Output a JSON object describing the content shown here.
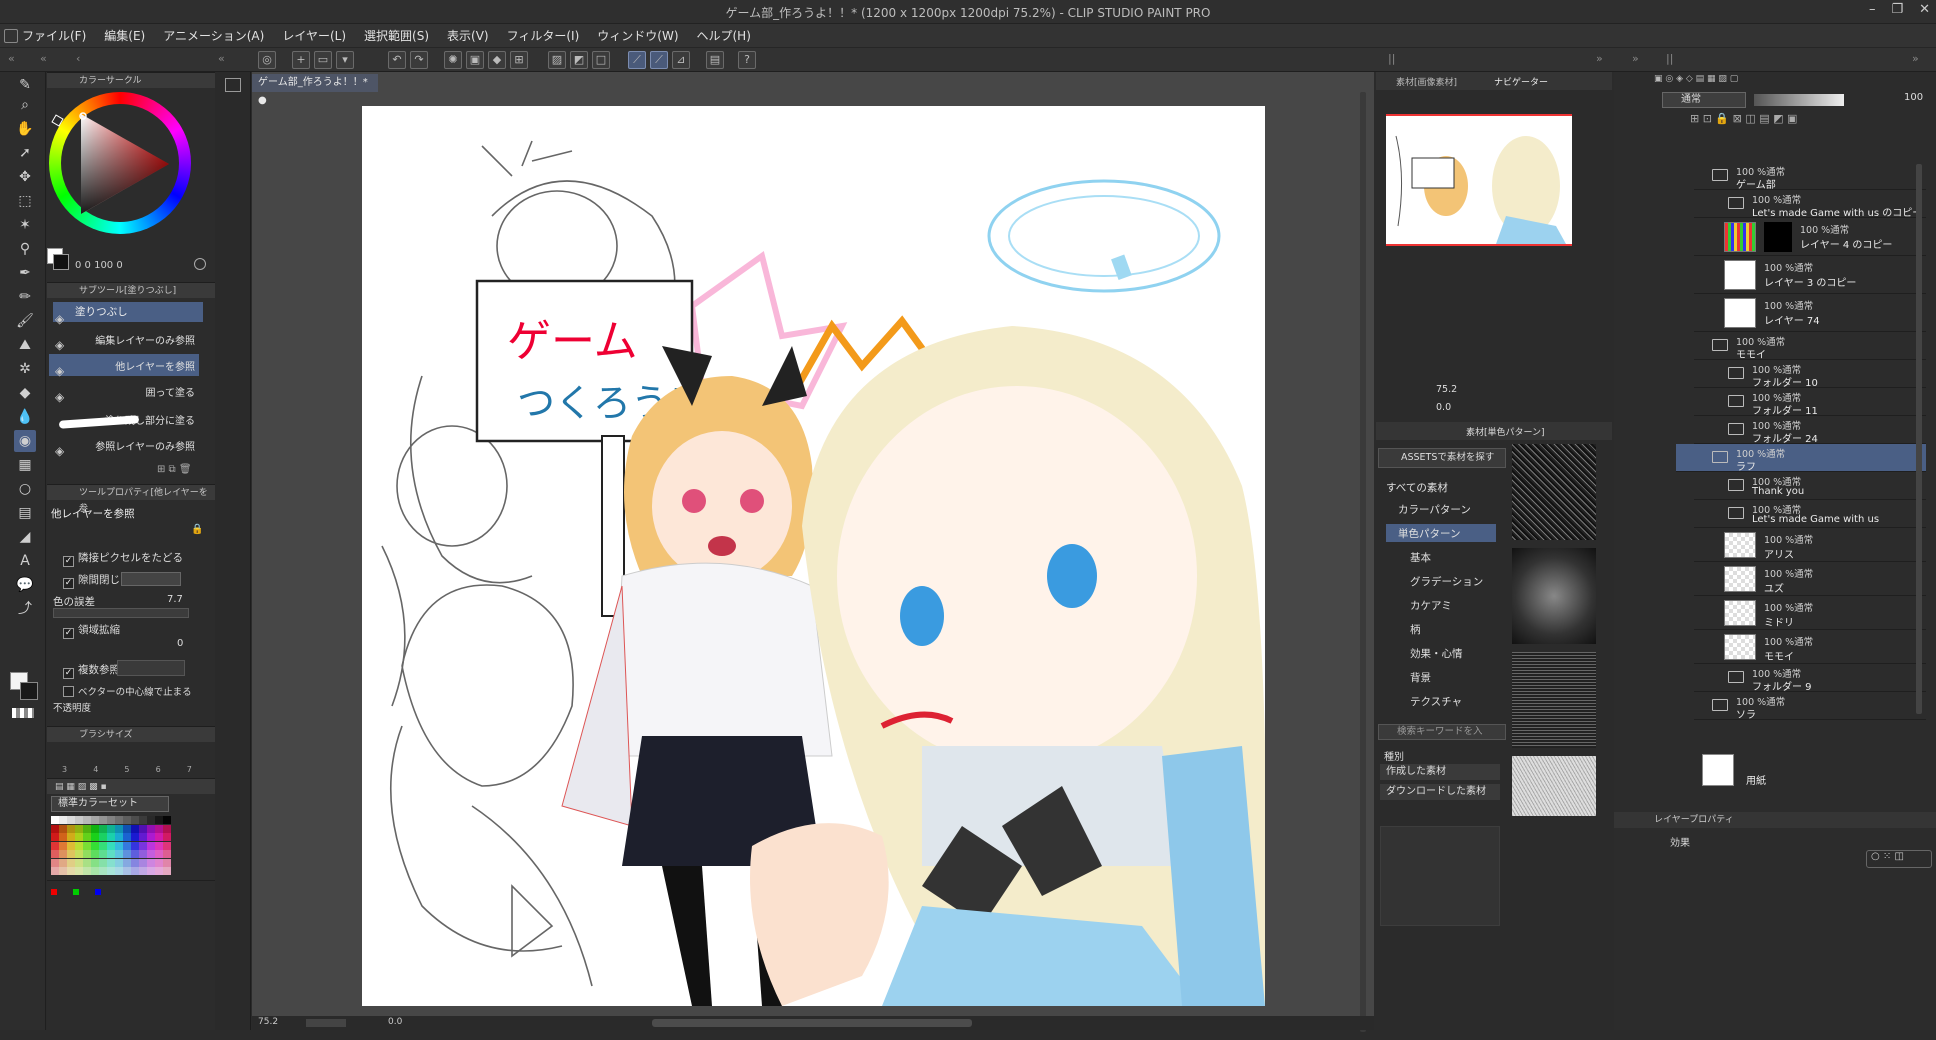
{
  "window": {
    "title": "ゲーム部_作ろうよ！！* (1200 x 1200px 1200dpi 75.2%)  - CLIP STUDIO PAINT PRO",
    "buttons": [
      "–",
      "❐",
      "✕"
    ]
  },
  "menu": [
    "ファイル(F)",
    "編集(E)",
    "アニメーション(A)",
    "レイヤー(L)",
    "選択範囲(S)",
    "表示(V)",
    "フィルター(I)",
    "ウィンドウ(W)",
    "ヘルプ(H)"
  ],
  "document": {
    "tab_label": "ゲーム部_作ろうよ！！*"
  },
  "color_circle": {
    "title": "カラーサークル",
    "value_readout": "0  0 100  0"
  },
  "sub_tool": {
    "title": "サブツール[塗りつぶし]",
    "group_label": "塗りつぶし",
    "items": [
      "編集レイヤーのみ参照",
      "他レイヤーを参照",
      "囲って塗る",
      "塗り残し部分に塗る",
      "参照レイヤーのみ参照"
    ],
    "selected_index": 1
  },
  "tool_property": {
    "title": "ツールプロパティ[他レイヤーを参",
    "tool_name": "他レイヤーを参照",
    "options": [
      {
        "label": "隣接ピクセルをたどる",
        "checked": true
      },
      {
        "label": "隙間閉じ",
        "checked": true
      },
      {
        "label": "色の誤差",
        "value": "7.7"
      },
      {
        "label": "領域拡縮",
        "checked": true,
        "value": "0"
      },
      {
        "label": "複数参照",
        "checked": true
      },
      {
        "label": "ベクターの中心線で止まる",
        "checked": false
      },
      {
        "label": "不透明度",
        "checked": false
      }
    ]
  },
  "brush_size": {
    "title": "ブラシサイズ",
    "sizes": [
      "3",
      "4",
      "5",
      "6",
      "7"
    ]
  },
  "color_set": {
    "dropdown": "標準カラーセット"
  },
  "navigator": {
    "tabs": [
      "素材[画像素材]",
      "ナビゲーター"
    ],
    "zoom": "75.2",
    "rotate": "0.0"
  },
  "materials": {
    "tab": "素材[単色パターン]",
    "search_assets": "ASSETSで素材を探す",
    "tree": [
      "すべての素材",
      "カラーパターン",
      "単色パターン",
      "基本",
      "グラデーション",
      "カケアミ",
      "柄",
      "効果・心情",
      "背景",
      "テクスチャ"
    ],
    "selected": "単色パターン",
    "search_placeholder": "検索キーワードを入",
    "kind_label": "種別",
    "kind_options": [
      "作成した素材",
      "ダウンロードした素材"
    ]
  },
  "layer_panel": {
    "blend_mode": "通常",
    "opacity": "100",
    "layers": [
      {
        "opacity": "100 %通常",
        "name": "ゲーム部",
        "kind": "folder"
      },
      {
        "opacity": "100 %通常",
        "name": "Let's made Game with us のコピー",
        "kind": "folder"
      },
      {
        "opacity": "100 %通常",
        "name": "レイヤー 4 のコピー",
        "kind": "layer"
      },
      {
        "opacity": "100 %通常",
        "name": "レイヤー 3 のコピー",
        "kind": "layer"
      },
      {
        "opacity": "100 %通常",
        "name": "レイヤー 74",
        "kind": "layer"
      },
      {
        "opacity": "100 %通常",
        "name": "モモイ",
        "kind": "folder"
      },
      {
        "opacity": "100 %通常",
        "name": "フォルダー 10",
        "kind": "folder"
      },
      {
        "opacity": "100 %通常",
        "name": "フォルダー 11",
        "kind": "folder"
      },
      {
        "opacity": "100 %通常",
        "name": "フォルダー 24",
        "kind": "folder"
      },
      {
        "opacity": "100 %通常",
        "name": "ラフ",
        "kind": "folder"
      },
      {
        "opacity": "100 %通常",
        "name": "Thank you",
        "kind": "folder"
      },
      {
        "opacity": "100 %通常",
        "name": "Let's made Game with us",
        "kind": "folder"
      },
      {
        "opacity": "100 %通常",
        "name": "アリス",
        "kind": "layer"
      },
      {
        "opacity": "100 %通常",
        "name": "ユズ",
        "kind": "layer"
      },
      {
        "opacity": "100 %通常",
        "name": "ミドリ",
        "kind": "layer"
      },
      {
        "opacity": "100 %通常",
        "name": "モモイ",
        "kind": "layer"
      },
      {
        "opacity": "100 %通常",
        "name": "フォルダー 9",
        "kind": "folder"
      },
      {
        "opacity": "100 %通常",
        "name": "ソラ",
        "kind": "folder"
      },
      {
        "opacity": "",
        "name": "用紙",
        "kind": "paper"
      }
    ],
    "selected_name": "ラフ"
  },
  "layer_property": {
    "title": "レイヤープロパティ",
    "effect_label": "効果"
  },
  "statusbar": {
    "zoom": "75.2",
    "angle": "0.0"
  },
  "artwork": {
    "sign_line1": "ゲーム",
    "sign_line2": "つくろう!"
  },
  "colors": {
    "accent_select": "#4a5f85",
    "panel_bg": "#2c2c2c",
    "canvas_bg": "#474747"
  }
}
